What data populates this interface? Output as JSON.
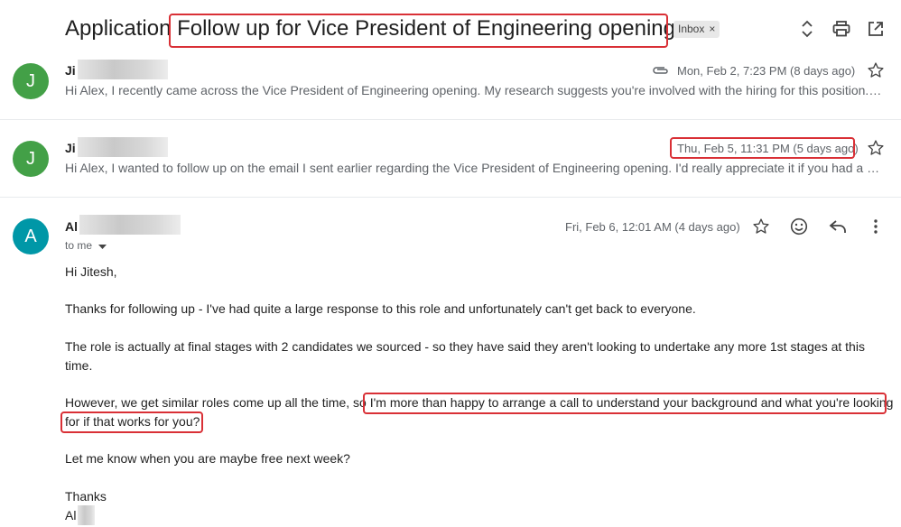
{
  "thread": {
    "subject_prefix": "Application",
    "subject_highlight": "Follow up for Vice President of Engineering opening",
    "label_chip": "Inbox",
    "label_chip_close": "×"
  },
  "messages": [
    {
      "avatar_letter": "J",
      "avatar_color": "#43a047",
      "sender_visible": "Ji",
      "date": "Mon, Feb 2, 7:23 PM (8 days ago)",
      "snippet": "Hi Alex, I recently came across the Vice President of Engineering opening. My research suggests you're involved with the hiring for this position. S..."
    },
    {
      "avatar_letter": "J",
      "avatar_color": "#43a047",
      "sender_visible": "Ji",
      "date": "Thu, Feb 5, 11:31 PM (5 days ago)",
      "snippet": "Hi Alex, I wanted to follow up on the email I sent earlier regarding the Vice President of Engineering opening. I'd really appreciate it if you had a ch..."
    },
    {
      "avatar_letter": "A",
      "avatar_color": "#0097a7",
      "sender_visible": "Al",
      "date": "Fri, Feb 6, 12:01 AM (4 days ago)",
      "to_label": "to me",
      "body": {
        "greeting": "Hi Jitesh,",
        "p1": "Thanks for following up - I've had quite a large response to this role and unfortunately can't get back to everyone.",
        "p2": "The role is actually at final stages with 2 candidates we sourced - so they have said they aren't looking to undertake any more 1st stages at this time.",
        "p3_start": "However, we get similar roles come up all the time, so ",
        "p3_highlight_a": "I'm more than happy to arrange a call to understand your background and what you're looking",
        "p3_highlight_b": "for if that works for you?",
        "p4": "Let me know when you are maybe free next week?",
        "signoff": "Thanks",
        "signature_visible": "Al"
      }
    }
  ],
  "colors": {
    "highlight": "#d93036"
  },
  "icons": [
    "expand-collapse-icon",
    "print-icon",
    "open-in-new-window-icon",
    "attachment-icon",
    "star-icon",
    "emoji-icon",
    "reply-icon",
    "more-vert-icon",
    "dropdown-arrow-icon"
  ]
}
